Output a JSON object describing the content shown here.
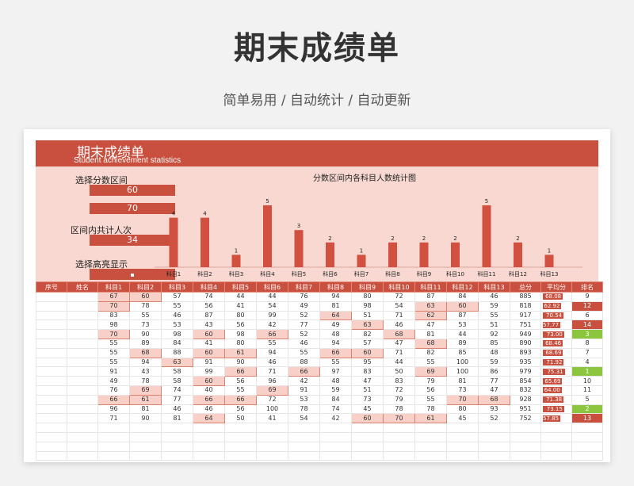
{
  "header": {
    "title": "期末成绩单",
    "subtitle": "简单易用  /  自动统计  /  自动更新"
  },
  "sheet": {
    "title": "期末成绩单",
    "subtitle_en": "Student achievement statistics",
    "labels": {
      "select_range": "选择分数区间",
      "range_min": "60",
      "range_max": "70",
      "total_label": "区间内共计人次",
      "total_value": "34",
      "highlight_label": "选择高亮显示"
    }
  },
  "chart_data": {
    "type": "bar",
    "title": "分数区间内各科目人数统计图",
    "categories": [
      "科目1",
      "科目2",
      "科目3",
      "科目4",
      "科目5",
      "科目6",
      "科目7",
      "科目8",
      "科目9",
      "科目10",
      "科目11",
      "科目12",
      "科目13"
    ],
    "values": [
      4,
      4,
      1,
      5,
      3,
      2,
      1,
      2,
      2,
      2,
      5,
      2,
      1
    ],
    "ylim": [
      0,
      5.5
    ],
    "color": "#d2503f"
  },
  "table": {
    "headers": [
      "序号",
      "姓名",
      "科目1",
      "科目2",
      "科目3",
      "科目4",
      "科目5",
      "科目6",
      "科目7",
      "科目8",
      "科目9",
      "科目10",
      "科目11",
      "科目12",
      "科目13",
      "总分",
      "平均分",
      "排名"
    ],
    "rows": [
      [
        67,
        60,
        57,
        74,
        44,
        44,
        76,
        94,
        80,
        72,
        87,
        84,
        46,
        885,
        "68.08",
        9
      ],
      [
        70,
        78,
        55,
        56,
        41,
        54,
        49,
        81,
        98,
        54,
        63,
        60,
        59,
        818,
        "62.92",
        12
      ],
      [
        83,
        55,
        46,
        87,
        80,
        99,
        52,
        64,
        51,
        71,
        62,
        87,
        55,
        917,
        "70.54",
        6
      ],
      [
        98,
        73,
        53,
        43,
        56,
        42,
        77,
        49,
        63,
        46,
        47,
        53,
        51,
        751,
        "57.77",
        14
      ],
      [
        70,
        90,
        98,
        60,
        98,
        66,
        52,
        48,
        82,
        68,
        81,
        44,
        92,
        949,
        "73.00",
        3
      ],
      [
        55,
        89,
        84,
        41,
        80,
        55,
        46,
        94,
        57,
        47,
        68,
        89,
        85,
        890,
        "68.46",
        8
      ],
      [
        55,
        68,
        88,
        60,
        61,
        94,
        55,
        66,
        60,
        71,
        82,
        85,
        48,
        893,
        "68.69",
        7
      ],
      [
        55,
        94,
        63,
        91,
        90,
        46,
        88,
        55,
        95,
        44,
        55,
        100,
        59,
        935,
        "71.92",
        4
      ],
      [
        91,
        43,
        58,
        99,
        66,
        71,
        66,
        97,
        83,
        50,
        69,
        100,
        86,
        979,
        "75.31",
        1
      ],
      [
        49,
        78,
        58,
        60,
        56,
        96,
        42,
        48,
        47,
        83,
        79,
        81,
        77,
        854,
        "65.69",
        10
      ],
      [
        76,
        69,
        74,
        40,
        55,
        69,
        91,
        59,
        51,
        72,
        56,
        73,
        47,
        832,
        "64.00",
        11
      ],
      [
        66,
        61,
        77,
        66,
        66,
        72,
        53,
        84,
        73,
        79,
        55,
        70,
        68,
        928,
        "71.38",
        5
      ],
      [
        96,
        81,
        46,
        46,
        56,
        100,
        78,
        74,
        45,
        78,
        78,
        80,
        93,
        951,
        "73.15",
        2
      ],
      [
        71,
        90,
        81,
        64,
        50,
        41,
        54,
        42,
        60,
        70,
        61,
        45,
        52,
        752,
        "57.85",
        13
      ]
    ],
    "avg_fraction": [
      0.68,
      0.63,
      0.71,
      0.58,
      0.73,
      0.68,
      0.69,
      0.72,
      0.75,
      0.66,
      0.64,
      0.71,
      0.73,
      0.58
    ],
    "rank_style": [
      "",
      "red",
      "",
      "red",
      "green",
      "",
      "",
      "",
      "green",
      "",
      "",
      "",
      "green",
      "red"
    ],
    "empty_rows": 4
  }
}
